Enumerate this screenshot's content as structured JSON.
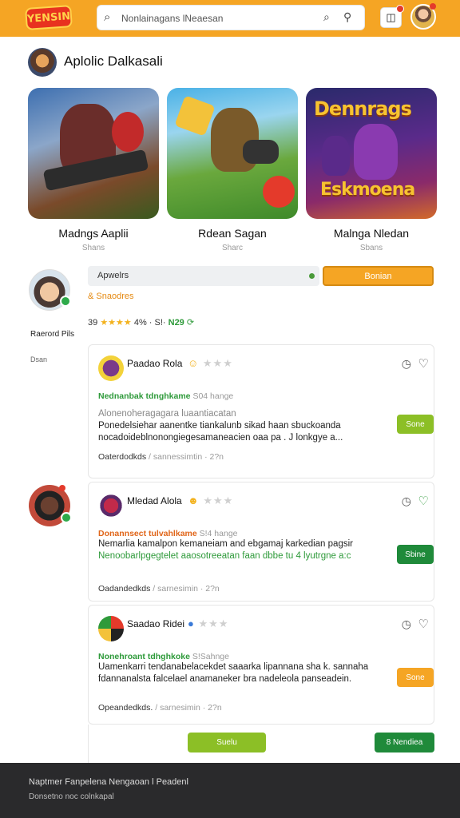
{
  "header": {
    "logo_text": "YENSIN",
    "search_value": "Nonlainagans lNeaesan",
    "search_icon": "search-icon",
    "notification_icon": "bell-icon"
  },
  "section": {
    "title": "Aplolic Dalkasali"
  },
  "games": [
    {
      "title": "Madngs Aaplii",
      "sub": "Shans"
    },
    {
      "title": "Rdean Sagan",
      "sub": "Sharc"
    },
    {
      "title": "Malnga Nledan",
      "sub": "Sbans"
    }
  ],
  "game_art": {
    "card3_banner_top": "Dennrags",
    "card3_banner_bottom": "Eskmoena"
  },
  "profile": {
    "name": "Raerord Pils",
    "sub": "Dsan"
  },
  "filter": {
    "label": "Apwelrs",
    "button": "Bonian",
    "tag": "& Snaodres",
    "stats_prefix": "39",
    "stars": "★★★★",
    "stats_mid": "4% · S!· ",
    "stats_highlight": "N29",
    "stats_arrow": "⟳"
  },
  "reviews": [
    {
      "name": "Paadao Rola",
      "emoji": "☺",
      "stars_empty": "★★★",
      "meta_highlight": "Nednanbak tdnghkame",
      "meta_rest": " S04 hange",
      "body_muted": "Alonenoheragagara luaantiacatan",
      "body": "Ponedelsiehar aanentke tiankalunb sikad haan sbuckoanda nocadoideblnonongiegesamaneacien oaa pa . J lonkgye a...",
      "foot": "Oaterdodkds",
      "foot_grey": " / sannessimtin · 2?n",
      "button": "Sone"
    },
    {
      "name": "Mledad Alola",
      "emoji": "☻",
      "stars_empty": "★★★",
      "meta_highlight": "Donannsect tulvahlkame",
      "meta_rest": " S!4 hange",
      "body": "Nemarlia kamalpon kemaneiam and ebgamaj karkedian pagsir",
      "body_green": "Nenoobarlpgegtelet aaosotreeatan faan dbbe tu 4 lyutrgne a:c",
      "foot": "Oadandedkds",
      "foot_grey": " / sarnesimin · 2?n",
      "button": "Sbine"
    },
    {
      "name": "Saadao Ridei",
      "emoji": "●",
      "stars_empty": "★★★",
      "meta_highlight": "Nonehroant tdhghkoke",
      "meta_rest": " S!Sahnge",
      "body": "Uamenkarri tendanabelacekdet saaarka lipannana sha k. sannaha fdannanalsta falcelael anamaneker bra nadeleola panseadein.",
      "foot": "Opeandedkds.",
      "foot_grey": " / sarnesimin · 2?n",
      "button": "Sone"
    }
  ],
  "bottom_buttons": {
    "left": "Suelu",
    "right": "8 Nendiea"
  },
  "footer": {
    "line1": "Naptmer Fanpelena Nengaoan l Peadenl",
    "line2": "Donsetno noc colnkapal"
  },
  "colors": {
    "accent": "#f5a524",
    "green": "#2e9a3a",
    "lime": "#8cbf26",
    "dark_green": "#1f8a3a",
    "footer": "#2a2a2c"
  }
}
